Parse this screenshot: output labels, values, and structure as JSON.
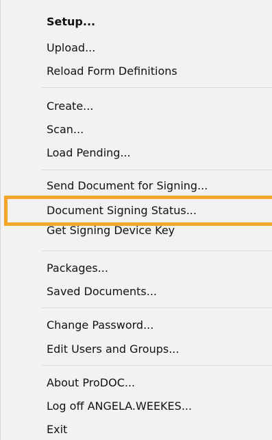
{
  "menu": {
    "items": [
      {
        "label": "Setup..."
      },
      {
        "label": "Upload..."
      },
      {
        "label": "Reload Form Definitions"
      },
      {
        "label": "Create..."
      },
      {
        "label": "Scan..."
      },
      {
        "label": "Load Pending..."
      },
      {
        "label": "Send Document for Signing..."
      },
      {
        "label": "Document Signing Status..."
      },
      {
        "label": "Get Signing Device Key"
      },
      {
        "label": "Packages..."
      },
      {
        "label": "Saved Documents..."
      },
      {
        "label": "Change Password..."
      },
      {
        "label": "Edit Users and Groups..."
      },
      {
        "label": "About ProDOC..."
      },
      {
        "label": "Log off ANGELA.WEEKES..."
      },
      {
        "label": "Exit"
      }
    ],
    "highlight_color": "#f4a62a"
  }
}
